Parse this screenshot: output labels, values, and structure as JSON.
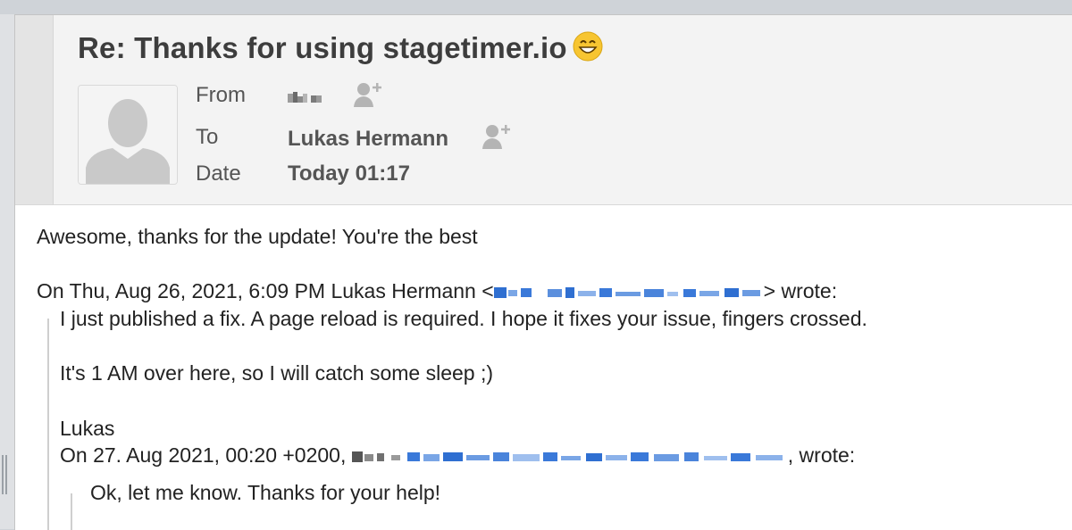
{
  "message": {
    "subject": "Re: Thanks for using stagetimer.io",
    "subject_emoji": "grinning-face-icon",
    "from_label": "From",
    "to_label": "To",
    "to_value": "Lukas Hermann",
    "date_label": "Date",
    "date_value": "Today 01:17"
  },
  "body": {
    "line1": "Awesome, thanks for the update! You're the best",
    "quote_header_prefix": "On Thu, Aug 26, 2021, 6:09 PM Lukas Hermann <",
    "quote_header_suffix": "> wrote:",
    "q1": "I just published a fix. A page reload is required. I hope it fixes your issue, fingers crossed.",
    "q2": "It's 1 AM over here, so I will catch some sleep ;)",
    "q3": "Lukas",
    "q4_prefix": "On 27. Aug 2021, 00:20 +0200, ",
    "q4_suffix": ", wrote:",
    "q5": "Ok, let me know. Thanks for your help!"
  },
  "colors": {
    "link": "#1a73e8",
    "header_bg": "#f3f3f3",
    "text": "#222222"
  }
}
